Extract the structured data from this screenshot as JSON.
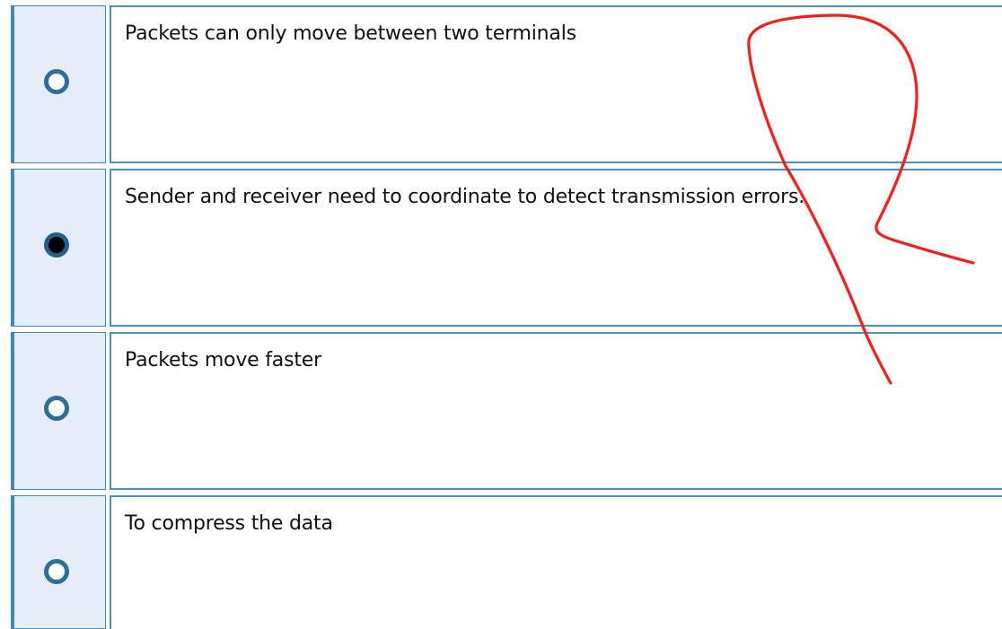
{
  "quiz": {
    "options": [
      {
        "label": "Packets can only move between two terminals",
        "selected": false
      },
      {
        "label": "Sender and receiver need to coordinate to detect transmission errors.",
        "selected": true
      },
      {
        "label": "Packets move faster",
        "selected": false
      },
      {
        "label": "To compress the data",
        "selected": false
      }
    ]
  },
  "colors": {
    "cell_background": "#e6ecf8",
    "border": "#4a92c2",
    "radio_border": "#2d6f99",
    "annotation": "#ff1a1a"
  },
  "icons": {
    "radio_unselected": "radio-unchecked-icon",
    "radio_selected": "radio-checked-icon",
    "annotation": "red-handwritten-mark"
  }
}
